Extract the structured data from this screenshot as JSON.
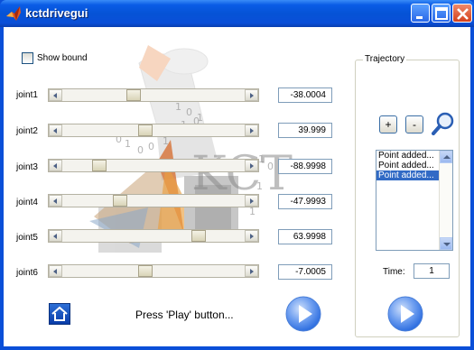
{
  "window": {
    "title": "kctdrivegui"
  },
  "show_bound": {
    "label": "Show bound",
    "checked": false
  },
  "joints": [
    {
      "label": "joint1",
      "value": "-38.0004",
      "slider_fraction": 0.38
    },
    {
      "label": "joint2",
      "value": "39.999",
      "slider_fraction": 0.45
    },
    {
      "label": "joint3",
      "value": "-88.9998",
      "slider_fraction": 0.18
    },
    {
      "label": "joint4",
      "value": "-47.9993",
      "slider_fraction": 0.3
    },
    {
      "label": "joint5",
      "value": "63.9998",
      "slider_fraction": 0.77
    },
    {
      "label": "joint6",
      "value": "-7.0005",
      "slider_fraction": 0.45
    }
  ],
  "logo_text": "KCT",
  "status": "Press 'Play' button...",
  "trajectory": {
    "title": "Trajectory",
    "add_label": "+",
    "remove_label": "-",
    "points": [
      {
        "label": "Point added...",
        "selected": false
      },
      {
        "label": "Point added...",
        "selected": false
      },
      {
        "label": "Point added...",
        "selected": true
      }
    ],
    "time_label": "Time:",
    "time_value": "1"
  },
  "icons": {
    "app": "matlab-icon",
    "minimize": "minimize-icon",
    "maximize": "maximize-icon",
    "close": "close-icon",
    "home": "home-icon",
    "play": "play-icon",
    "zoom": "magnifier-icon"
  },
  "colors": {
    "titlebar": "#0a4fd8",
    "selection": "#316ac5",
    "play_blue": "#2f6fe0"
  }
}
